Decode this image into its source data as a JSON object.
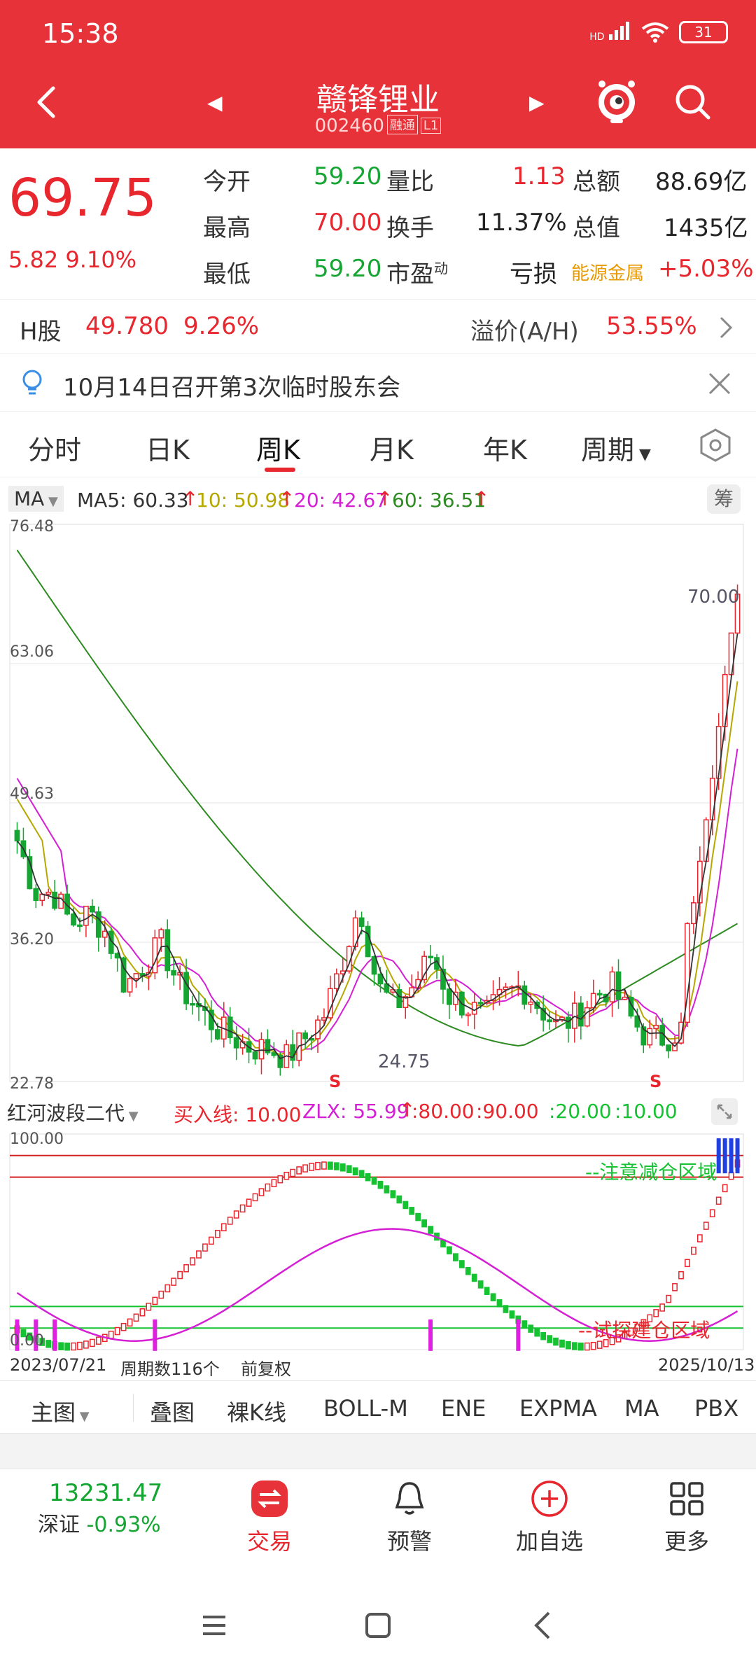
{
  "status": {
    "time": "15:38",
    "network": "HD",
    "battery": "31"
  },
  "nav": {
    "stock_name": "赣锋锂业",
    "stock_code": "002460",
    "badge1": "融",
    "badge2": "通",
    "badge3": "L1"
  },
  "quote": {
    "price": "69.75",
    "change": "5.82",
    "change_pct": "9.10%",
    "rows": [
      {
        "l1": "今开",
        "v1": "59.20",
        "l2": "量比",
        "v2": "1.13",
        "l3": "总额",
        "v3": "88.69亿"
      },
      {
        "l1": "最高",
        "v1": "70.00",
        "l2": "换手",
        "v2": "11.37%",
        "l3": "总值",
        "v3": "1435亿"
      },
      {
        "l1": "最低",
        "v1": "59.20",
        "l2": "市盈",
        "l2sup": "动",
        "v2": "亏损",
        "l3": "能源金属",
        "v3": "+5.03%"
      }
    ]
  },
  "hshare": {
    "label": "H股",
    "price": "49.780",
    "pct": "9.26%",
    "premium_label": "溢价(A/H)",
    "premium": "53.55%"
  },
  "notice": {
    "text": "10月14日召开第3次临时股东会"
  },
  "tabs": [
    "分时",
    "日K",
    "周K",
    "月K",
    "年K",
    "周期"
  ],
  "ma_legend": {
    "selector": "MA",
    "ma5": "MA5: 60.33",
    "ma10": "10: 50.98",
    "ma20": "20: 42.67",
    "ma60": "60: 36.51",
    "chip_btn": "筹",
    "colors": {
      "ma5": "#333333",
      "ma10": "#b5a800",
      "ma20": "#d41fd4",
      "ma60": "#2e8b22"
    }
  },
  "chart_data": {
    "type": "candlestick",
    "y_ticks": [
      "76.48",
      "63.06",
      "49.63",
      "36.20",
      "22.78"
    ],
    "ylim": [
      22.78,
      76.48
    ],
    "max_label": "70.00",
    "min_label": "24.75",
    "s_marks": [
      "S",
      "S"
    ],
    "x_start": "2023/07/21",
    "x_end": "2025/10/13",
    "periods_label": "周期数116个",
    "adjust_label": "前复权"
  },
  "indicator": {
    "selector": "红河波段二代",
    "buy": "买入线: 10.00",
    "zlx": "ZLX: 55.99",
    "l80": ":80.00",
    "l90": ":90.00",
    "l20": ":20.00",
    "l10": ":10.00",
    "top_tick": "100.00",
    "bottom_tick": "0.00",
    "zone_top": "--注意减仓区域",
    "zone_bottom": "--试探建仓区域"
  },
  "toolbar": [
    "主图",
    "叠图",
    "裸K线",
    "BOLL-M",
    "ENE",
    "EXPMA",
    "MA",
    "PBX"
  ],
  "bottom": {
    "index_value": "13231.47",
    "index_name": "深证",
    "index_pct": "-0.93%",
    "trade": "交易",
    "alert": "预警",
    "add": "加自选",
    "more": "更多"
  }
}
